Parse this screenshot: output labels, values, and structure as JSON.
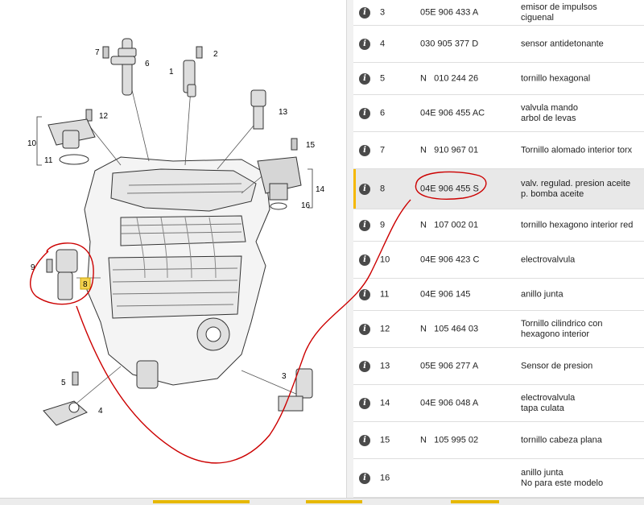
{
  "diagram": {
    "callouts": [
      "1",
      "2",
      "3",
      "4",
      "5",
      "6",
      "7",
      "8",
      "9",
      "10",
      "11",
      "12",
      "13",
      "14",
      "15",
      "16"
    ]
  },
  "parts": [
    {
      "pos": "3",
      "part_number": "05E 906 433 A",
      "desc_lines": [
        "emisor de impulsos",
        "ciguenal"
      ],
      "selected": false
    },
    {
      "pos": "4",
      "part_number": "030 905 377 D",
      "desc_lines": [
        "sensor antidetonante"
      ],
      "selected": false
    },
    {
      "pos": "5",
      "part_number": "N   010 244 26",
      "desc_lines": [
        "tornillo hexagonal"
      ],
      "selected": false
    },
    {
      "pos": "6",
      "part_number": "04E 906 455 AC",
      "desc_lines": [
        "valvula mando",
        "arbol de levas"
      ],
      "selected": false
    },
    {
      "pos": "7",
      "part_number": "N   910 967 01",
      "desc_lines": [
        "Tornillo alomado interior torx"
      ],
      "selected": false
    },
    {
      "pos": "8",
      "part_number": "04E 906 455 S",
      "desc_lines": [
        "valv. regulad. presion aceite",
        "p. bomba aceite"
      ],
      "selected": true
    },
    {
      "pos": "9",
      "part_number": "N   107 002 01",
      "desc_lines": [
        "tornillo hexagono interior red"
      ],
      "selected": false
    },
    {
      "pos": "10",
      "part_number": "04E 906 423 C",
      "desc_lines": [
        "electrovalvula"
      ],
      "selected": false
    },
    {
      "pos": "11",
      "part_number": "04E 906 145",
      "desc_lines": [
        "anillo junta"
      ],
      "selected": false
    },
    {
      "pos": "12",
      "part_number": "N   105 464 03",
      "desc_lines": [
        "Tornillo cilindrico con",
        "hexagono interior"
      ],
      "selected": false
    },
    {
      "pos": "13",
      "part_number": "05E 906 277 A",
      "desc_lines": [
        "Sensor de presion"
      ],
      "selected": false
    },
    {
      "pos": "14",
      "part_number": "04E 906 048 A",
      "desc_lines": [
        "electrovalvula",
        "tapa culata"
      ],
      "selected": false
    },
    {
      "pos": "15",
      "part_number": "N   105 995 02",
      "desc_lines": [
        "tornillo cabeza plana"
      ],
      "selected": false
    },
    {
      "pos": "16",
      "part_number": "",
      "desc_lines": [
        "anillo junta",
        "No para este modelo"
      ],
      "selected": false
    }
  ],
  "icons": {
    "info": "info-icon"
  },
  "info_glyph": "i",
  "colors": {
    "accent": "#f5b800",
    "selected_row": "#e8e8e8",
    "annotation": "#cc0000"
  }
}
